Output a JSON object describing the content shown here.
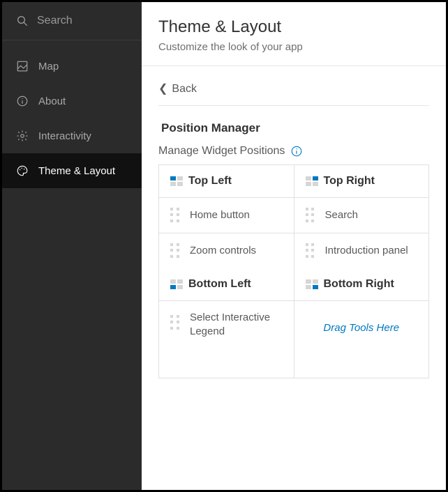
{
  "sidebar": {
    "search_placeholder": "Search",
    "items": [
      {
        "label": "Map"
      },
      {
        "label": "About"
      },
      {
        "label": "Interactivity"
      },
      {
        "label": "Theme & Layout"
      }
    ]
  },
  "header": {
    "title": "Theme & Layout",
    "subtitle": "Customize the look of your app"
  },
  "back_label": "Back",
  "position_manager": {
    "title": "Position Manager",
    "subtitle": "Manage Widget Positions",
    "quadrants": {
      "tl": {
        "label": "Top Left",
        "items": [
          "Home button",
          "Zoom controls"
        ]
      },
      "tr": {
        "label": "Top Right",
        "items": [
          "Search",
          "Introduction panel"
        ]
      },
      "bl": {
        "label": "Bottom Left",
        "items": [
          "Select Interactive Legend"
        ]
      },
      "br": {
        "label": "Bottom Right",
        "drop_text": "Drag Tools Here"
      }
    }
  }
}
